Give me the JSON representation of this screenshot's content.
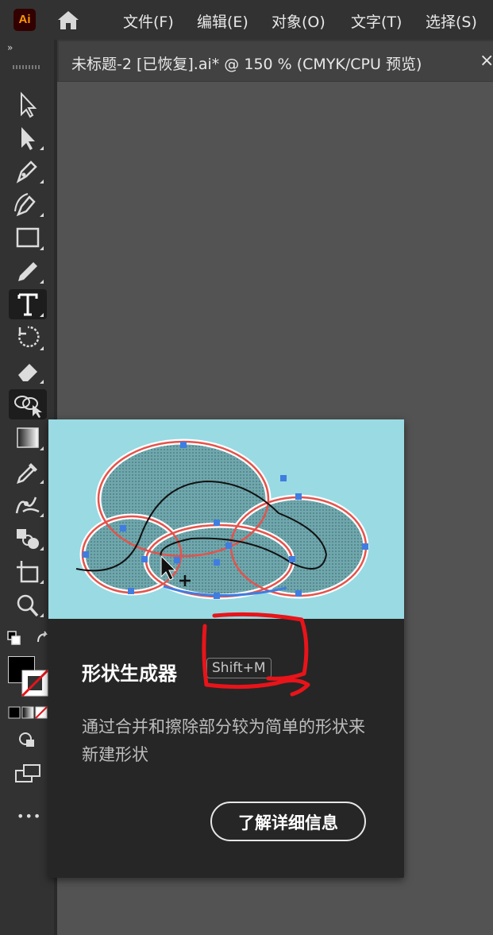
{
  "app": {
    "logo_text": "Ai",
    "home_icon": "home-icon"
  },
  "menu": [
    {
      "label": "文件(F)"
    },
    {
      "label": "编辑(E)"
    },
    {
      "label": "对象(O)"
    },
    {
      "label": "文字(T)"
    },
    {
      "label": "选择(S)"
    }
  ],
  "document": {
    "tab_title": "未标题-2  [已恢复].ai* @ 150 % (CMYK/CPU 预览)",
    "close_glyph": "×"
  },
  "toolbar": {
    "collapse_glyph": "»",
    "tools": [
      "selection-icon",
      "direct-selection-icon",
      "pen-icon",
      "curvature-icon",
      "rectangle-icon",
      "pencil-icon",
      "type-icon",
      "rotate-icon",
      "eraser-icon",
      "shape-builder-icon",
      "gradient-icon",
      "eyedropper-icon",
      "puppet-warp-icon",
      "blend-icon",
      "artboard-icon",
      "zoom-icon"
    ],
    "active_tool": "type-icon",
    "hovered_tool": "shape-builder-icon",
    "more_glyph": "•••",
    "fill_color": "#000000",
    "stroke_color": "#ffffff"
  },
  "tooltip": {
    "title": "形状生成器",
    "shortcut": "Shift+M",
    "description": "通过合并和擦除部分较为简单的形状来新建形状",
    "learn_more": "了解详细信息",
    "illustration_bg": "#99dae3"
  },
  "colors": {
    "menubar": "#323232",
    "canvas": "#535353",
    "card": "#262626",
    "annotation": "#e8141a"
  }
}
